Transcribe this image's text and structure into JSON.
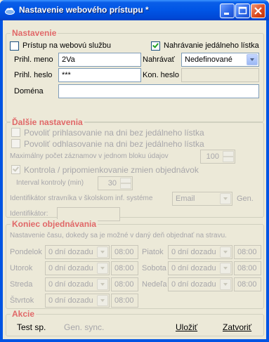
{
  "window": {
    "title": "Nastavenie webového prístupu *"
  },
  "nastavenie": {
    "legend": "Nastavenie",
    "pristup_label": "Prístup na webovú službu",
    "pristup_checked": false,
    "nahravanie_label": "Nahrávanie jedálneho lístka",
    "nahravanie_checked": true,
    "prihl_meno_label": "Prihl. meno",
    "prihl_meno_value": "2Va",
    "nahravat_label": "Nahrávať",
    "nahravat_value": "Nedefinované",
    "prihl_heslo_label": "Prihl. heslo",
    "prihl_heslo_value": "***",
    "kon_heslo_label": "Kon. heslo",
    "domena_label": "Doména",
    "domena_value": ""
  },
  "dalsie": {
    "legend": "Ďalšie nastavenia",
    "prihlasovanie_label": "Povoliť prihlasovanie na dni bez jedálneho lístka",
    "odhlasovanie_label": "Povoliť odhlasovanie na dni bez jedálneho lístka",
    "max_zaznamov_label": "Maximálny počet záznamov v jednom bloku údajov",
    "max_zaznamov_value": "100",
    "kontrola_label": "Kontrola / pripomienkovanie zmien objednávok",
    "kontrola_checked": true,
    "interval_label": "Interval kontroly (min)",
    "interval_value": "30",
    "identifikator_system_label": "Identifikátor stravníka v školskom inf. systéme",
    "identifikator_system_value": "Email",
    "gen_label": "Gen.",
    "identifikator_label": "Identifikátor:",
    "identifikator_value": ""
  },
  "koniec": {
    "legend": "Koniec objednávania",
    "description": "Nastavenie času, dokedy sa je možné v daný deň objednať na stravu.",
    "days": [
      {
        "name": "Pondelok",
        "option": "0 dní dozadu",
        "time": "08:00"
      },
      {
        "name": "Utorok",
        "option": "0 dní dozadu",
        "time": "08:00"
      },
      {
        "name": "Streda",
        "option": "0 dní dozadu",
        "time": "08:00"
      },
      {
        "name": "Štvrtok",
        "option": "0 dní dozadu",
        "time": "08:00"
      },
      {
        "name": "Piatok",
        "option": "0 dní dozadu",
        "time": "08:00"
      },
      {
        "name": "Sobota",
        "option": "0 dní dozadu",
        "time": "08:00"
      },
      {
        "name": "Nedeľa",
        "option": "0 dní dozadu",
        "time": "08:00"
      }
    ]
  },
  "akcie": {
    "legend": "Akcie",
    "test_label": "Test sp.",
    "gen_sync_label": "Gen. sync.",
    "ulozit_label": "Uložiť",
    "zatvorit_label": "Zatvoriť"
  }
}
